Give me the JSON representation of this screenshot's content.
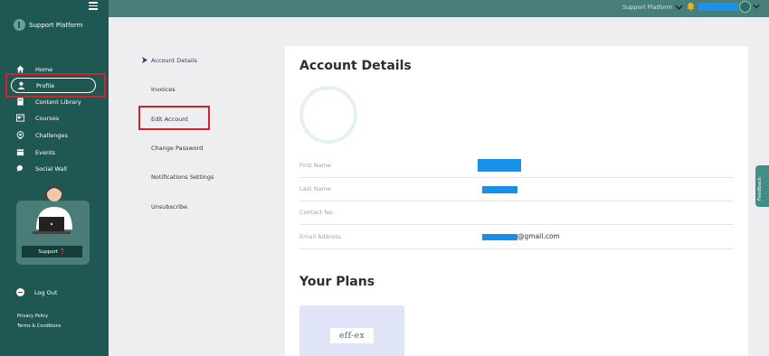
{
  "brand": {
    "name": "Support Platform"
  },
  "sidebar": {
    "items": [
      {
        "label": "Home",
        "icon": "home-icon"
      },
      {
        "label": "Profile",
        "icon": "user-icon",
        "active": true
      },
      {
        "label": "Content Library",
        "icon": "book-icon"
      },
      {
        "label": "Courses",
        "icon": "courses-icon"
      },
      {
        "label": "Challenges",
        "icon": "target-icon"
      },
      {
        "label": "Events",
        "icon": "calendar-icon"
      },
      {
        "label": "Social Wall",
        "icon": "chat-icon"
      }
    ],
    "support_label": "Support ❓",
    "logout_label": "Log Out",
    "privacy_label": "Privacy Policy",
    "terms_label": "Terms & Conditions"
  },
  "topbar": {
    "platform_label": "Support Platform"
  },
  "submenu": {
    "items": [
      {
        "label": "Account Details",
        "active": true
      },
      {
        "label": "Invoices"
      },
      {
        "label": "Edit Account"
      },
      {
        "label": "Change Password"
      },
      {
        "label": "Notifications Settings"
      },
      {
        "label": "Unsubscribe"
      }
    ]
  },
  "main": {
    "title": "Account Details",
    "fields": [
      {
        "label": "First Name",
        "value": ""
      },
      {
        "label": "Last Name",
        "value": ""
      },
      {
        "label": "Contact No.",
        "value": ""
      },
      {
        "label": "Email Address",
        "value": "@gmail.com"
      }
    ],
    "plans_title": "Your Plans",
    "plan_logo_text": "eff-ex"
  },
  "feedback_label": "Feedback",
  "colors": {
    "sidebar": "#1f5753",
    "topbar": "#477e79",
    "highlight": "#d0242b",
    "redaction": "#1890ea"
  }
}
